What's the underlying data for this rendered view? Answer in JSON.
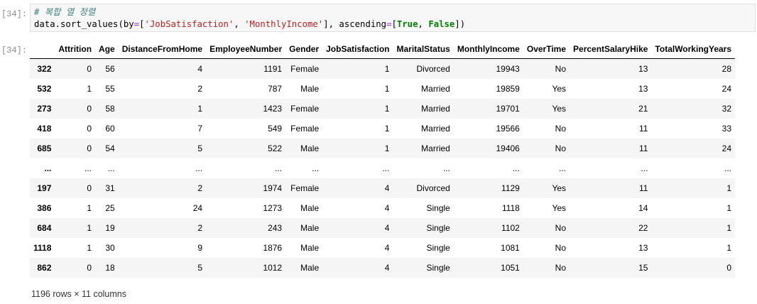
{
  "input_prompt": "[34]:",
  "output_prompt": "[34]:",
  "code": {
    "comment": "# 복합 열 정렬",
    "line2_prefix": "data.sort_values(by",
    "eq1": "=",
    "open1": "[",
    "str1": "'JobSatisfaction'",
    "comma1": ", ",
    "str2": "'MonthlyIncome'",
    "close1": "], ascending",
    "eq2": "=",
    "open2": "[",
    "kw1": "True",
    "comma2": ", ",
    "kw2": "False",
    "close2": "])"
  },
  "table": {
    "columns": [
      "",
      "Attrition",
      "Age",
      "DistanceFromHome",
      "EmployeeNumber",
      "Gender",
      "JobSatisfaction",
      "MaritalStatus",
      "MonthlyIncome",
      "OverTime",
      "PercentSalaryHike",
      "TotalWorkingYears"
    ],
    "rows": [
      [
        "322",
        "0",
        "56",
        "4",
        "1191",
        "Female",
        "1",
        "Divorced",
        "19943",
        "No",
        "13",
        "28"
      ],
      [
        "532",
        "1",
        "55",
        "2",
        "787",
        "Male",
        "1",
        "Married",
        "19859",
        "Yes",
        "13",
        "24"
      ],
      [
        "273",
        "0",
        "58",
        "1",
        "1423",
        "Female",
        "1",
        "Married",
        "19701",
        "Yes",
        "21",
        "32"
      ],
      [
        "418",
        "0",
        "60",
        "7",
        "549",
        "Female",
        "1",
        "Married",
        "19566",
        "No",
        "11",
        "33"
      ],
      [
        "685",
        "0",
        "54",
        "5",
        "522",
        "Male",
        "1",
        "Married",
        "19406",
        "No",
        "11",
        "24"
      ],
      [
        "...",
        "...",
        "...",
        "...",
        "...",
        "...",
        "...",
        "...",
        "...",
        "...",
        "...",
        "..."
      ],
      [
        "197",
        "0",
        "31",
        "2",
        "1974",
        "Female",
        "4",
        "Divorced",
        "1129",
        "Yes",
        "11",
        "1"
      ],
      [
        "386",
        "1",
        "25",
        "24",
        "1273",
        "Male",
        "4",
        "Single",
        "1118",
        "Yes",
        "14",
        "1"
      ],
      [
        "684",
        "1",
        "19",
        "2",
        "243",
        "Male",
        "4",
        "Single",
        "1102",
        "No",
        "22",
        "1"
      ],
      [
        "1118",
        "1",
        "30",
        "9",
        "1876",
        "Male",
        "4",
        "Single",
        "1081",
        "No",
        "13",
        "1"
      ],
      [
        "862",
        "0",
        "18",
        "5",
        "1012",
        "Male",
        "4",
        "Single",
        "1051",
        "No",
        "15",
        "0"
      ]
    ]
  },
  "summary": "1196 rows × 11 columns"
}
